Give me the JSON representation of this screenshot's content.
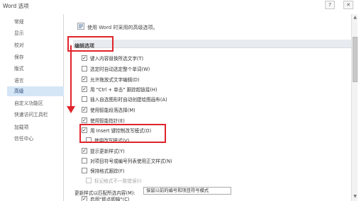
{
  "window": {
    "title": "Word 选项",
    "help_label": "?",
    "close_label": "✕"
  },
  "sidebar": {
    "items": [
      {
        "label": "常规"
      },
      {
        "label": "显示"
      },
      {
        "label": "校对"
      },
      {
        "label": "保存"
      },
      {
        "label": "版式"
      },
      {
        "label": "语言"
      },
      {
        "label": "高级"
      },
      {
        "label": "自定义功能区"
      },
      {
        "label": "快速访问工具栏"
      },
      {
        "label": "加载项"
      },
      {
        "label": "信任中心"
      }
    ],
    "active_label": "高级"
  },
  "header": {
    "icon": "settings-icon",
    "text": "使用 Word 时采用的高级选项。"
  },
  "section": {
    "title": "编辑选项"
  },
  "options": [
    {
      "label": "键入内容替换所选文字(T)",
      "checked": true
    },
    {
      "label": "选定时自动选定整个单词(W)",
      "checked": false
    },
    {
      "label": "允许拖放式文字编辑(D)",
      "checked": true
    },
    {
      "label": "用 \"Ctrl + 单击\" 跟踪超链接(H)",
      "checked": true
    },
    {
      "label": "插入自选图形时自动创建绘图画布(A)",
      "checked": false
    },
    {
      "label": "使用智能段落选择(M)",
      "checked": true
    },
    {
      "label": "使用智能指针(E)",
      "checked": true
    },
    {
      "label": "用 Insert 键控制改写模式(O)",
      "checked": true
    },
    {
      "label": "使用改写模式(V)",
      "checked": false
    },
    {
      "label": "提示更新样式(Y)",
      "checked": true
    },
    {
      "label": "对项目符号或编号列表使用正文样式(N)",
      "checked": false
    },
    {
      "label": "保持格式跟踪(F)",
      "checked": false
    },
    {
      "label": "标记格式不一致错误(I)",
      "checked": false,
      "disabled": true
    }
  ],
  "paste_row": {
    "label": "更新样式以匹配所选内容(M):",
    "select_value": "保留以前的编号和项目符号模式"
  },
  "last_option": {
    "label": "启用\"即点即输\"(C)",
    "checked": true
  },
  "colors": {
    "annotation_red": "#e0242b",
    "active_nav": "#d5e6f6",
    "section_bar": "#e8ecf0"
  }
}
